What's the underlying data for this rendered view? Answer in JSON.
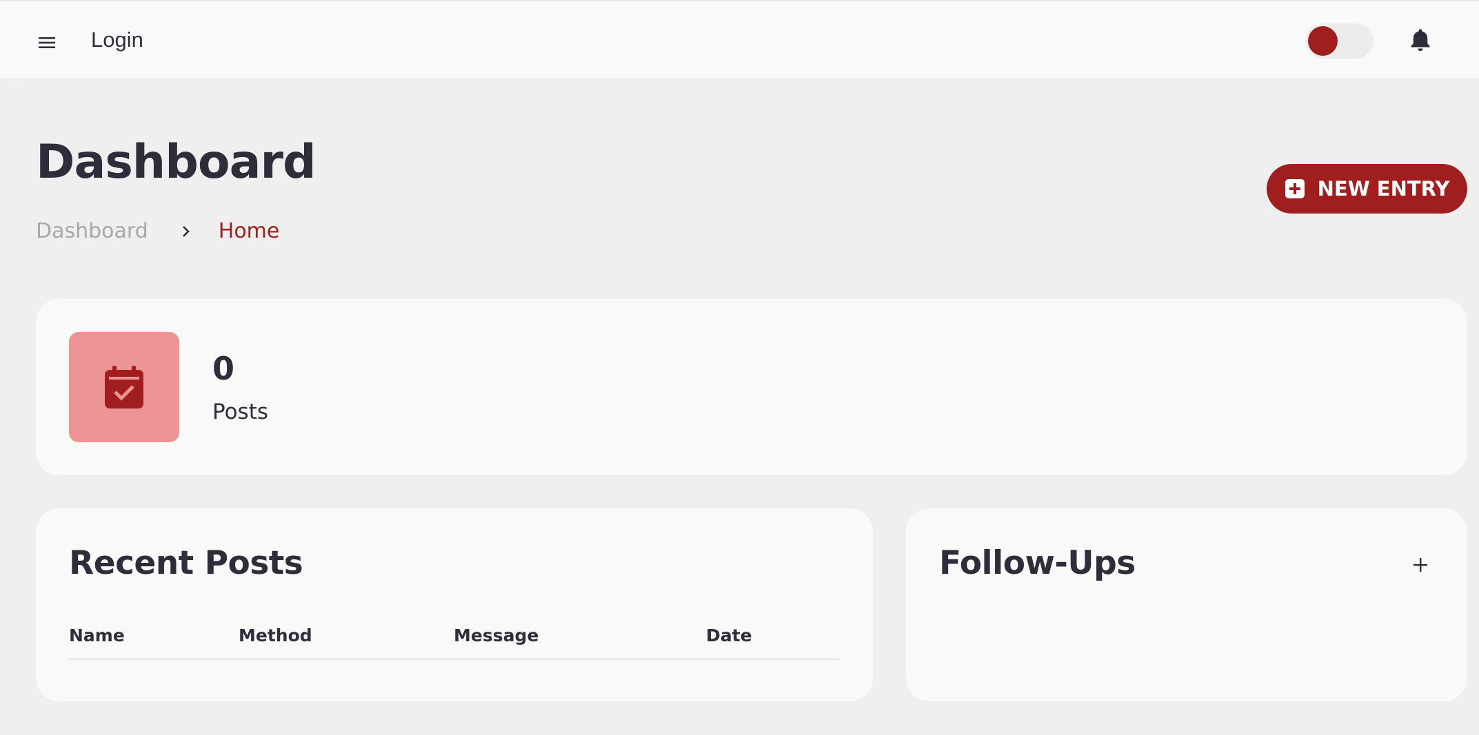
{
  "topbar": {
    "menu_icon": "hamburger-menu-icon",
    "login_label": "Login",
    "theme_toggle": {
      "on": true
    },
    "notification_icon": "bell-icon"
  },
  "colors": {
    "accent": "#a01f1e",
    "accent_light": "#ed9594",
    "text": "#302d3b",
    "muted": "#a8a8a8",
    "surface": "#f9f9f9",
    "background": "#efefef"
  },
  "page": {
    "title": "Dashboard",
    "breadcrumb": {
      "root": "Dashboard",
      "separator_icon": "chevron-right-icon",
      "current": "Home"
    },
    "new_entry_label": "NEW ENTRY",
    "new_entry_icon": "plus-square-icon"
  },
  "stats": {
    "icon": "calendar-check-icon",
    "value": "0",
    "label": "Posts"
  },
  "recent_posts": {
    "title": "Recent Posts",
    "columns": [
      "Name",
      "Method",
      "Message",
      "Date"
    ],
    "rows": []
  },
  "follow_ups": {
    "title": "Follow-Ups",
    "add_icon": "plus-icon"
  }
}
